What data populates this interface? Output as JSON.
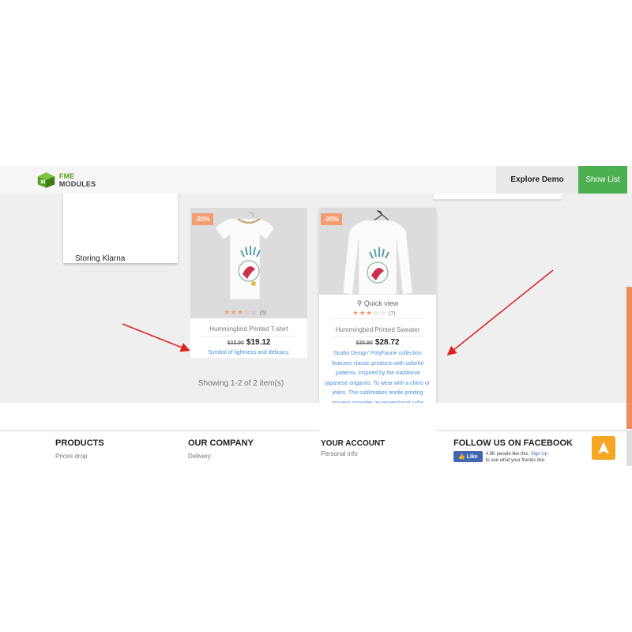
{
  "header": {
    "logo_text_a": "FME",
    "logo_text_b": " MODULES",
    "explore_label": "Explore Demo",
    "show_list_label": "Show List",
    "brand_color": "#4caf50"
  },
  "sidebar": {
    "item_label": "Storing Klarna"
  },
  "products": [
    {
      "badge": "-20%",
      "rating": 3,
      "review_count": "(5)",
      "name": "Hummingbird Printed T-shirt",
      "old_price": "$23.90",
      "price": "$19.12",
      "description": "Symbol of lightness and delicacy,"
    },
    {
      "badge": "-20%",
      "quick_view": "Quick view",
      "rating": 3,
      "review_count": "(7)",
      "name": "Hummingbird Printed Sweater",
      "old_price": "$35.90",
      "price": "$28.72",
      "description": "Studio Design' PolyFaune collection features classic products with colorful patterns, inspired by the traditional japanese origamis. To wear with a chino or jeans. The sublimation textile printing process provides an exceptional color rendering and a color, guaranteed overtime."
    }
  ],
  "listing": {
    "showing_text": "Showing 1-2 of 2 item(s)"
  },
  "footer": {
    "products_heading": "PRODUCTS",
    "products_link": "Prices drop",
    "company_heading": "OUR COMPANY",
    "company_link": "Delivery",
    "account_heading": "YOUR ACCOUNT",
    "account_link": "Personal info",
    "facebook_heading": "FOLLOW US ON FACEBOOK",
    "fb_like_label": "Like",
    "fb_count_text": "4.9K people like this.",
    "fb_signup": "Sign Up",
    "fb_tail": "to see what your friends like."
  },
  "colors": {
    "accent_orange": "#f39d72",
    "link_blue": "#4a90d9",
    "arrow_red": "#e02020",
    "scroll_top_bg": "#f5a623"
  }
}
